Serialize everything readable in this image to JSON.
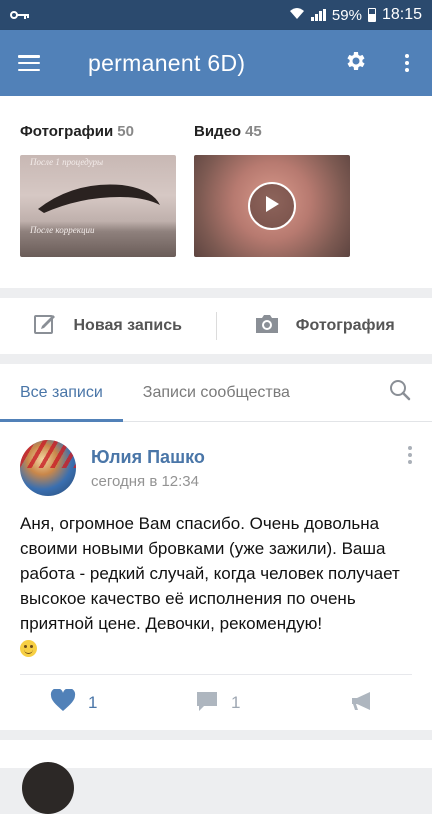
{
  "status_bar": {
    "battery": "59%",
    "time": "18:15"
  },
  "app_bar": {
    "title": "permanent 6D)"
  },
  "media": {
    "photos_label": "Фотографии",
    "photos_count": "50",
    "videos_label": "Видео",
    "videos_count": "45",
    "photo_caption_top": "После 1 процедуры",
    "photo_caption_bottom": "После коррекции"
  },
  "compose": {
    "new_post": "Новая запись",
    "photo": "Фотография"
  },
  "tabs": {
    "all_posts": "Все записи",
    "community_posts": "Записи сообщества"
  },
  "post": {
    "author": "Юлия Пашко",
    "time": "сегодня в 12:34",
    "text": "Аня, огромное Вам спасибо. Очень довольна своими новыми бровками (уже зажили). Ваша работа - редкий случай, когда человек получает высокое качество её исполнения по очень приятной цене. Девочки, рекомендую!",
    "emoji": "wink-emoji",
    "likes": "1",
    "comments": "1"
  },
  "colors": {
    "status_bar": "#2b4a6e",
    "app_bar": "#5181b8",
    "accent": "#4a76a8",
    "background": "#edeef0"
  },
  "icons": [
    "key-icon",
    "wifi-icon",
    "signal-icon",
    "battery-icon",
    "menu-icon",
    "gear-icon",
    "more-vertical-icon",
    "play-icon",
    "edit-icon",
    "camera-icon",
    "search-icon",
    "heart-icon",
    "comment-icon",
    "megaphone-icon"
  ]
}
